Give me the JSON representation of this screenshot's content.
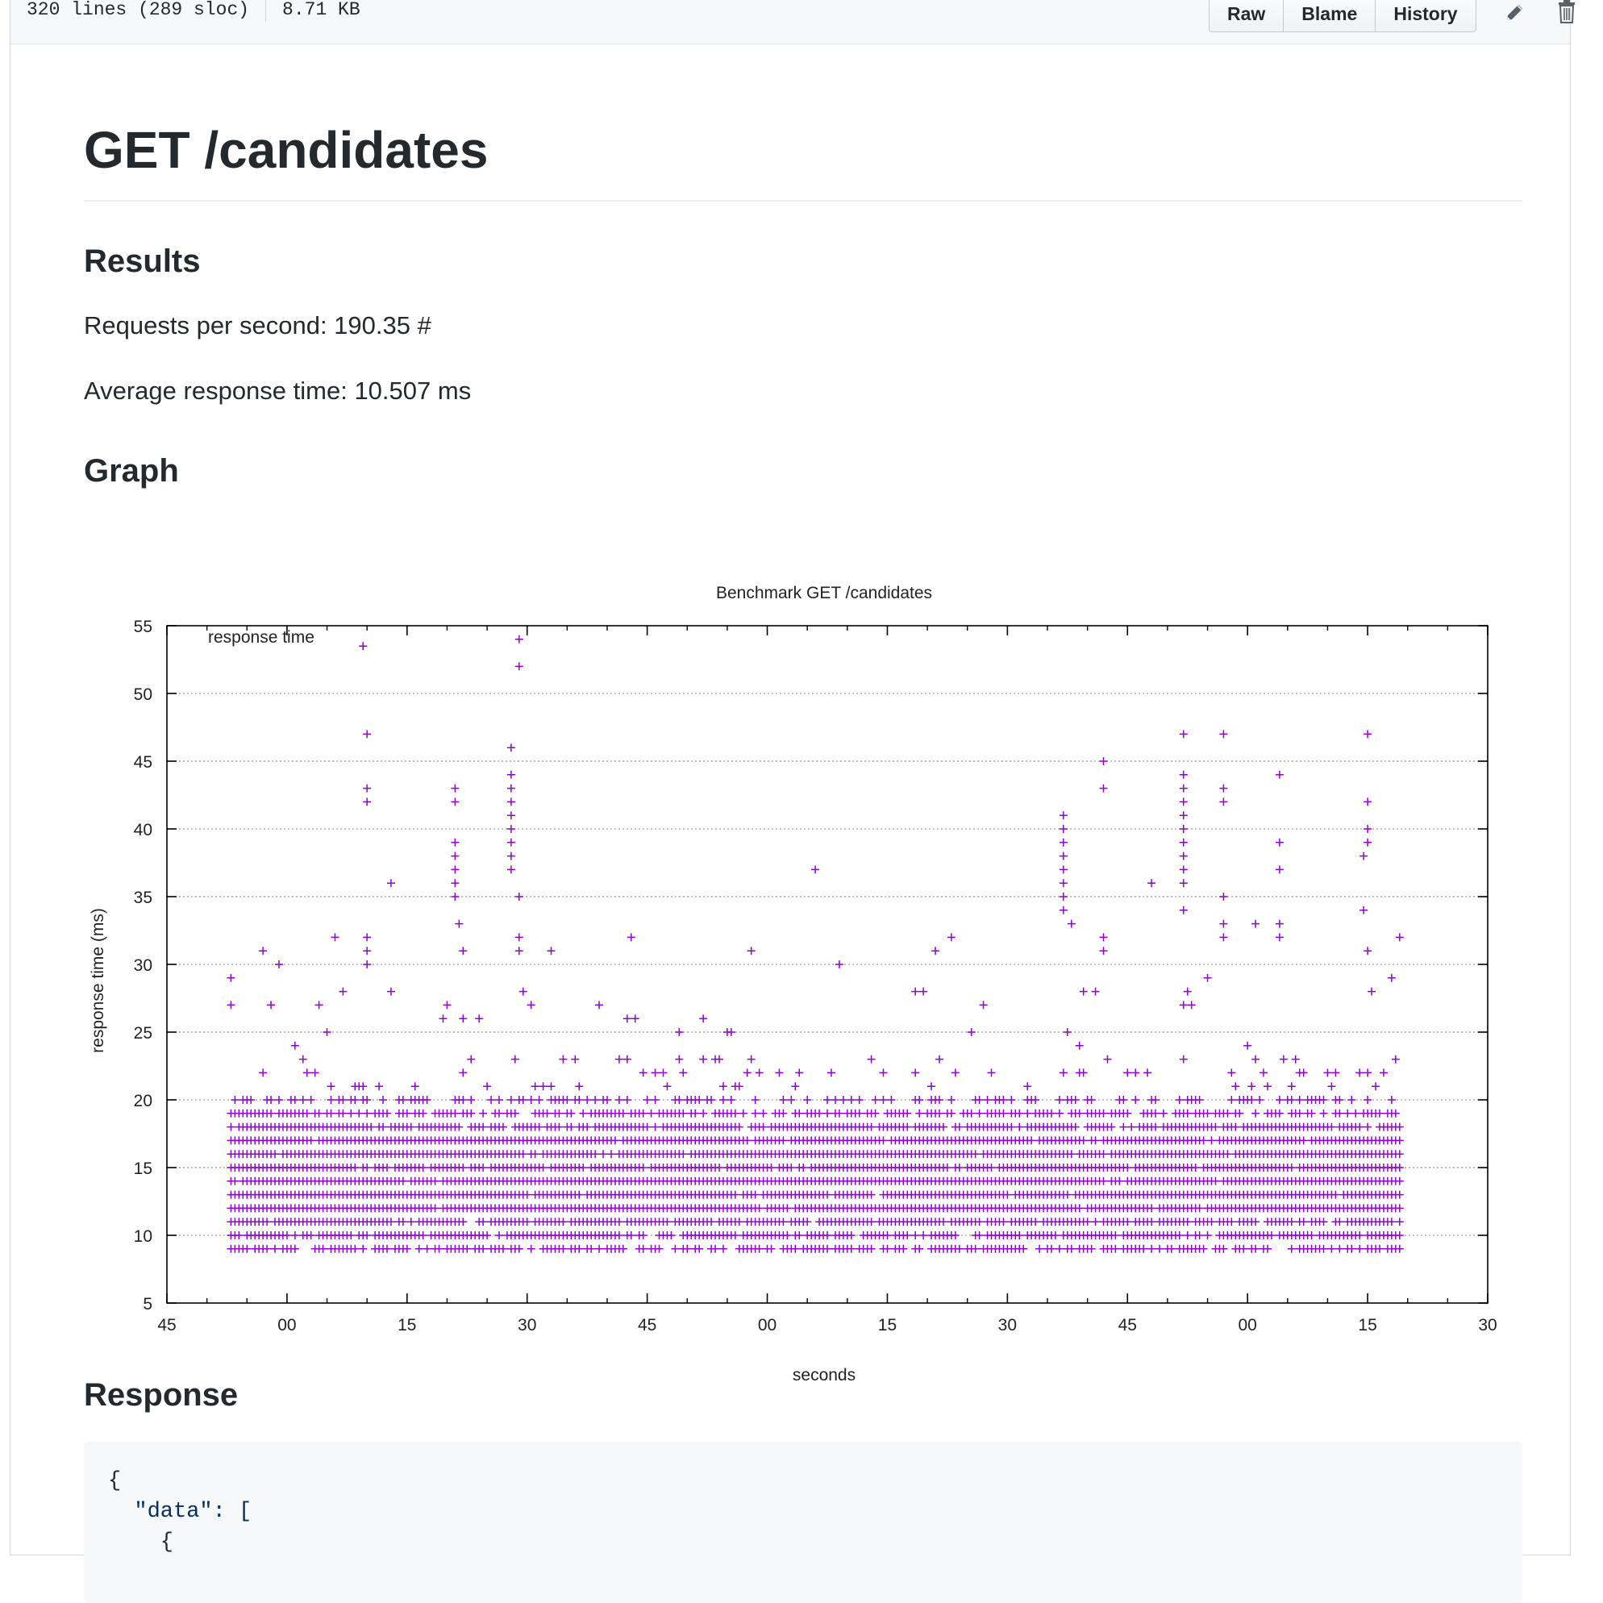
{
  "file_header": {
    "lines": "320 lines (289 sloc)",
    "size": "8.71 KB",
    "buttons": [
      "Raw",
      "Blame",
      "History"
    ],
    "icons": [
      "pencil-icon",
      "trash-icon"
    ]
  },
  "document": {
    "title": "GET /candidates",
    "results_heading": "Results",
    "requests_per_second": "Requests per second: 190.35 #",
    "avg_response_time": "Average response time: 10.507 ms",
    "graph_heading": "Graph",
    "response_heading": "Response",
    "code_lines": [
      "{",
      "  \"data\": [",
      "    {"
    ]
  },
  "chart_data": {
    "type": "scatter",
    "title": "Benchmark GET /candidates",
    "xlabel": "seconds",
    "ylabel": "response time (ms)",
    "legend": "response time",
    "legend_position": "top-left",
    "marker": "+",
    "color": "#9400d3",
    "grid": "horizontal dotted",
    "ylim": [
      5,
      55
    ],
    "yticks": [
      5,
      10,
      15,
      20,
      25,
      30,
      35,
      40,
      45,
      50,
      55
    ],
    "xlim_seconds": [
      0,
      165
    ],
    "xtick_labels": [
      "45",
      "00",
      "15",
      "30",
      "45",
      "00",
      "15",
      "30",
      "45",
      "00",
      "15",
      "30"
    ],
    "xtick_positions_seconds": [
      0,
      15,
      30,
      45,
      60,
      75,
      90,
      105,
      120,
      135,
      150,
      165
    ],
    "data_span_seconds": [
      8,
      154
    ],
    "dense_band_ms": [
      9,
      19
    ],
    "outliers": [
      {
        "x": 24.5,
        "y": 53.5
      },
      {
        "x": 44,
        "y": 54
      },
      {
        "x": 44,
        "y": 52
      },
      {
        "x": 25,
        "y": 47
      },
      {
        "x": 25,
        "y": 43
      },
      {
        "x": 25,
        "y": 42
      },
      {
        "x": 28,
        "y": 36
      },
      {
        "x": 36,
        "y": 43
      },
      {
        "x": 36,
        "y": 42
      },
      {
        "x": 36,
        "y": 39
      },
      {
        "x": 36,
        "y": 38
      },
      {
        "x": 36,
        "y": 37
      },
      {
        "x": 36,
        "y": 36
      },
      {
        "x": 36,
        "y": 35
      },
      {
        "x": 36.5,
        "y": 33
      },
      {
        "x": 43,
        "y": 46
      },
      {
        "x": 43,
        "y": 44
      },
      {
        "x": 43,
        "y": 43
      },
      {
        "x": 43,
        "y": 42
      },
      {
        "x": 43,
        "y": 41
      },
      {
        "x": 43,
        "y": 40
      },
      {
        "x": 43,
        "y": 39
      },
      {
        "x": 43,
        "y": 38
      },
      {
        "x": 43,
        "y": 37
      },
      {
        "x": 44,
        "y": 35
      },
      {
        "x": 81,
        "y": 37
      },
      {
        "x": 112,
        "y": 41
      },
      {
        "x": 112,
        "y": 40
      },
      {
        "x": 112,
        "y": 39
      },
      {
        "x": 112,
        "y": 38
      },
      {
        "x": 112,
        "y": 37
      },
      {
        "x": 112,
        "y": 36
      },
      {
        "x": 112,
        "y": 35
      },
      {
        "x": 112,
        "y": 34
      },
      {
        "x": 113,
        "y": 33
      },
      {
        "x": 117,
        "y": 45
      },
      {
        "x": 117,
        "y": 43
      },
      {
        "x": 123,
        "y": 36
      },
      {
        "x": 127,
        "y": 47
      },
      {
        "x": 127,
        "y": 44
      },
      {
        "x": 127,
        "y": 43
      },
      {
        "x": 127,
        "y": 42
      },
      {
        "x": 127,
        "y": 41
      },
      {
        "x": 127,
        "y": 40
      },
      {
        "x": 127,
        "y": 39
      },
      {
        "x": 127,
        "y": 38
      },
      {
        "x": 127,
        "y": 37
      },
      {
        "x": 127,
        "y": 36
      },
      {
        "x": 127,
        "y": 34
      },
      {
        "x": 132,
        "y": 47
      },
      {
        "x": 132,
        "y": 43
      },
      {
        "x": 132,
        "y": 42
      },
      {
        "x": 132,
        "y": 35
      },
      {
        "x": 139,
        "y": 44
      },
      {
        "x": 139,
        "y": 39
      },
      {
        "x": 139,
        "y": 37
      },
      {
        "x": 150,
        "y": 47
      },
      {
        "x": 150,
        "y": 42
      },
      {
        "x": 150,
        "y": 40
      },
      {
        "x": 150,
        "y": 39
      },
      {
        "x": 149.5,
        "y": 38
      },
      {
        "x": 149.5,
        "y": 34
      },
      {
        "x": 8,
        "y": 29
      },
      {
        "x": 8,
        "y": 27
      },
      {
        "x": 12,
        "y": 31
      },
      {
        "x": 14,
        "y": 30
      },
      {
        "x": 21,
        "y": 32
      },
      {
        "x": 25,
        "y": 32
      },
      {
        "x": 25,
        "y": 31
      },
      {
        "x": 25,
        "y": 30
      },
      {
        "x": 37,
        "y": 31
      },
      {
        "x": 44,
        "y": 32
      },
      {
        "x": 44,
        "y": 31
      },
      {
        "x": 48,
        "y": 31
      },
      {
        "x": 58,
        "y": 32
      },
      {
        "x": 73,
        "y": 31
      },
      {
        "x": 84,
        "y": 30
      },
      {
        "x": 96,
        "y": 31
      },
      {
        "x": 98,
        "y": 32
      },
      {
        "x": 117,
        "y": 32
      },
      {
        "x": 117,
        "y": 31
      },
      {
        "x": 132,
        "y": 33
      },
      {
        "x": 132,
        "y": 32
      },
      {
        "x": 136,
        "y": 33
      },
      {
        "x": 139,
        "y": 33
      },
      {
        "x": 139,
        "y": 32
      },
      {
        "x": 150,
        "y": 31
      },
      {
        "x": 154,
        "y": 32
      }
    ]
  }
}
